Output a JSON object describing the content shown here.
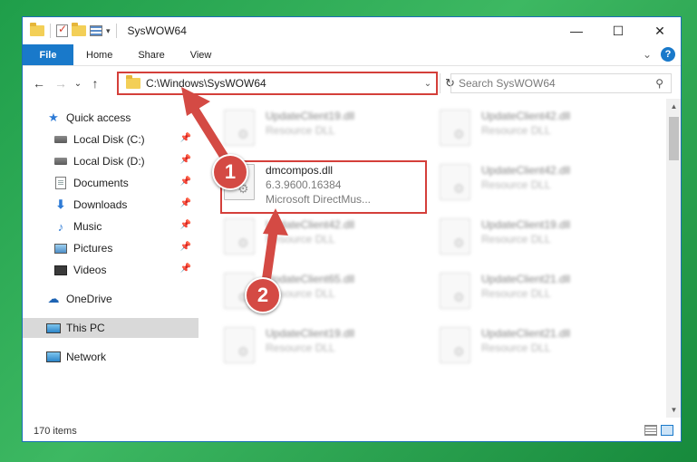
{
  "window": {
    "title": "SysWOW64",
    "controls": {
      "minimize": "—",
      "maximize": "☐",
      "close": "✕"
    }
  },
  "ribbon": {
    "tabs": [
      "File",
      "Home",
      "Share",
      "View"
    ],
    "expand_glyph": "⌄",
    "help_glyph": "?"
  },
  "nav": {
    "back": "←",
    "forward": "→",
    "recent": "⌄",
    "up": "↑",
    "address": "C:\\Windows\\SysWOW64",
    "address_dropdown": "⌄",
    "refresh": "↻",
    "search_placeholder": "Search SysWOW64",
    "search_icon": "search-icon"
  },
  "sidebar": {
    "items": [
      {
        "label": "Quick access",
        "icon": "star-icon",
        "pinned": false
      },
      {
        "label": "Local Disk (C:)",
        "icon": "disk-icon",
        "pinned": true
      },
      {
        "label": "Local Disk (D:)",
        "icon": "disk-icon",
        "pinned": true
      },
      {
        "label": "Documents",
        "icon": "documents-icon",
        "pinned": true
      },
      {
        "label": "Downloads",
        "icon": "downloads-icon",
        "pinned": true
      },
      {
        "label": "Music",
        "icon": "music-icon",
        "pinned": true
      },
      {
        "label": "Pictures",
        "icon": "pictures-icon",
        "pinned": true
      },
      {
        "label": "Videos",
        "icon": "videos-icon",
        "pinned": true
      },
      {
        "label": "OneDrive",
        "icon": "onedrive-icon",
        "pinned": false
      },
      {
        "label": "This PC",
        "icon": "this-pc-icon",
        "pinned": false,
        "selected": true
      },
      {
        "label": "Network",
        "icon": "network-icon",
        "pinned": false
      }
    ],
    "pin_glyph": "📌"
  },
  "files": {
    "left_column": [
      {
        "name": "UpdateClient19.dll",
        "line2": "Resource DLL",
        "blurred": true
      },
      {
        "name": "dmcompos.dll",
        "line2": "6.3.9600.16384",
        "line3": "Microsoft DirectMus...",
        "blurred": false
      },
      {
        "name": "UpdateClient42.dll",
        "line2": "Resource DLL",
        "blurred": true
      },
      {
        "name": "UpdateClient65.dll",
        "line2": "Resource DLL",
        "blurred": true
      },
      {
        "name": "UpdateClient19.dll",
        "line2": "Resource DLL",
        "blurred": true
      }
    ],
    "right_column": [
      {
        "name": "UpdateClient42.dll",
        "line2": "Resource DLL"
      },
      {
        "name": "UpdateClient42.dll",
        "line2": "Resource DLL"
      },
      {
        "name": "UpdateClient19.dll",
        "line2": "Resource DLL"
      },
      {
        "name": "UpdateClient21.dll",
        "line2": "Resource DLL"
      },
      {
        "name": "UpdateClient21.dll",
        "line2": "Resource DLL"
      }
    ]
  },
  "status": {
    "item_count": "170 items"
  },
  "annotations": {
    "step1": "1",
    "step2": "2",
    "color": "#d44a44"
  },
  "colors": {
    "accent": "#1979ca",
    "highlight": "#d43f3a",
    "desktop": "#2ea855"
  }
}
